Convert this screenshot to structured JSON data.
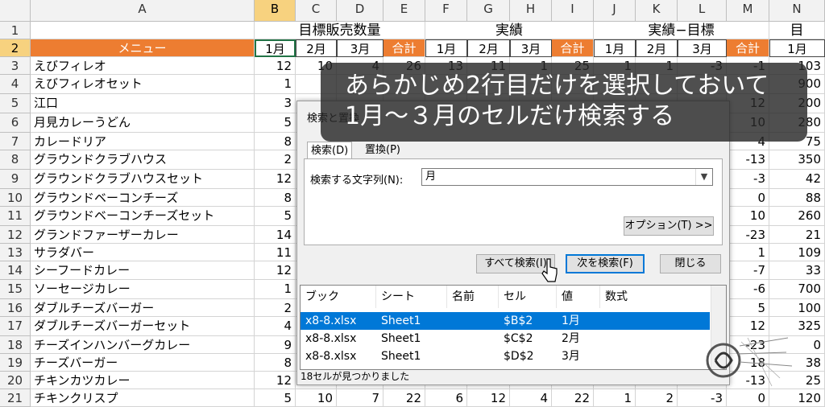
{
  "columns": [
    "A",
    "B",
    "C",
    "D",
    "E",
    "F",
    "G",
    "H",
    "I",
    "J",
    "K",
    "L",
    "M",
    "N"
  ],
  "row_numbers": [
    "1",
    "2",
    "3",
    "4",
    "5",
    "6",
    "7",
    "8",
    "9",
    "10",
    "11",
    "12",
    "13",
    "14",
    "15",
    "16",
    "17",
    "18",
    "19",
    "20",
    "21"
  ],
  "header_row1": {
    "target_group": "目標販売数量",
    "actual_group": "実績",
    "diff_group": "実績−目標",
    "last_group": "目"
  },
  "header_row2": [
    "メニュー",
    "1月",
    "2月",
    "3月",
    "合計",
    "1月",
    "2月",
    "3月",
    "合計",
    "1月",
    "2月",
    "3月",
    "合計",
    "1月"
  ],
  "menu_items": [
    "えびフィレオ",
    "えびフィレオセット",
    "江口",
    "月見カレーうどん",
    "カレードリア",
    "グラウンドクラブハウス",
    "グラウンドクラブハウスセット",
    "グラウンドベーコンチーズ",
    "グラウンドベーコンチーズセット",
    "グランドファーザーカレー",
    "サラダバー",
    "シーフードカレー",
    "ソーセージカレー",
    "ダブルチーズバーガー",
    "ダブルチーズバーガーセット",
    "チーズインハンバーグカレー",
    "チーズバーガー",
    "チキンカツカレー",
    "チキンクリスプ"
  ],
  "col_b": [
    "12",
    "1",
    "3",
    "5",
    "8",
    "2",
    "12",
    "8",
    "5",
    "14",
    "11",
    "12",
    "1",
    "2",
    "4",
    "9",
    "8",
    "12",
    "5"
  ],
  "col_c": [
    "10",
    "",
    "",
    "",
    "",
    "",
    "",
    "",
    "",
    "",
    "",
    "",
    "",
    "",
    "",
    "",
    "",
    "",
    "10"
  ],
  "col_d": [
    "4",
    "",
    "",
    "",
    "",
    "",
    "",
    "",
    "",
    "",
    "",
    "",
    "",
    "",
    "",
    "",
    "",
    "",
    "7"
  ],
  "col_e": [
    "26",
    "",
    "",
    "",
    "",
    "",
    "",
    "",
    "",
    "",
    "",
    "",
    "",
    "",
    "",
    "",
    "",
    "",
    "22"
  ],
  "col_f": [
    "13",
    "",
    "",
    "",
    "",
    "",
    "",
    "",
    "",
    "",
    "",
    "",
    "",
    "",
    "",
    "",
    "",
    "",
    "6"
  ],
  "col_g": [
    "11",
    "",
    "",
    "",
    "",
    "",
    "",
    "",
    "",
    "",
    "",
    "",
    "",
    "",
    "",
    "",
    "",
    "",
    "12"
  ],
  "col_h": [
    "1",
    "",
    "",
    "",
    "",
    "",
    "",
    "",
    "",
    "",
    "",
    "",
    "",
    "",
    "",
    "",
    "",
    "",
    "4"
  ],
  "col_i": [
    "25",
    "",
    "",
    "",
    "",
    "",
    "",
    "",
    "",
    "",
    "",
    "",
    "",
    "",
    "",
    "",
    "",
    "",
    "22"
  ],
  "col_j": [
    "1",
    "",
    "",
    "",
    "",
    "",
    "",
    "",
    "",
    "",
    "",
    "",
    "",
    "",
    "",
    "",
    "",
    "",
    "1"
  ],
  "col_k": [
    "1",
    "",
    "",
    "",
    "",
    "",
    "",
    "",
    "",
    "",
    "",
    "",
    "",
    "",
    "",
    "",
    "",
    "",
    "2"
  ],
  "col_l": [
    "-3",
    "",
    "",
    "",
    "",
    "",
    "",
    "",
    "",
    "",
    "",
    "",
    "",
    "",
    "",
    "",
    "",
    "",
    "-3"
  ],
  "col_m": [
    "-1",
    "",
    "12",
    "10",
    "4",
    "-13",
    "-3",
    "0",
    "10",
    "-23",
    "1",
    "-7",
    "-6",
    "5",
    "12",
    "-23",
    "18",
    "-13",
    "0"
  ],
  "col_n": [
    "103",
    "900",
    "200",
    "280",
    "75",
    "350",
    "42",
    "88",
    "260",
    "21",
    "109",
    "33",
    "700",
    "100",
    "325",
    "0",
    "38",
    "25",
    "120"
  ],
  "dialog": {
    "title": "検索と置換",
    "tab_find": "検索(D)",
    "tab_replace": "置換(P)",
    "find_label": "検索する文字列(N):",
    "find_value": "月",
    "options_button": "オプション(T) >>",
    "find_all_button": "すべて検索(I)",
    "find_next_button": "次を検索(F)",
    "close_button": "閉じる",
    "result_headers": [
      "ブック",
      "シート",
      "名前",
      "セル",
      "値",
      "数式"
    ],
    "results": [
      {
        "book": "x8-8.xlsx",
        "sheet": "Sheet1",
        "name": "",
        "cell": "$B$2",
        "value": "1月"
      },
      {
        "book": "x8-8.xlsx",
        "sheet": "Sheet1",
        "name": "",
        "cell": "$C$2",
        "value": "2月"
      },
      {
        "book": "x8-8.xlsx",
        "sheet": "Sheet1",
        "name": "",
        "cell": "$D$2",
        "value": "3月"
      }
    ],
    "status": "18セルが見つかりました"
  },
  "caption": {
    "line1": "あらかじめ2行目だけを選択しておいて",
    "line2": "1月〜３月のセルだけ検索する"
  },
  "colors": {
    "orange": "#ed7d31",
    "select_blue": "#0078d7",
    "excel_green": "#217346"
  }
}
